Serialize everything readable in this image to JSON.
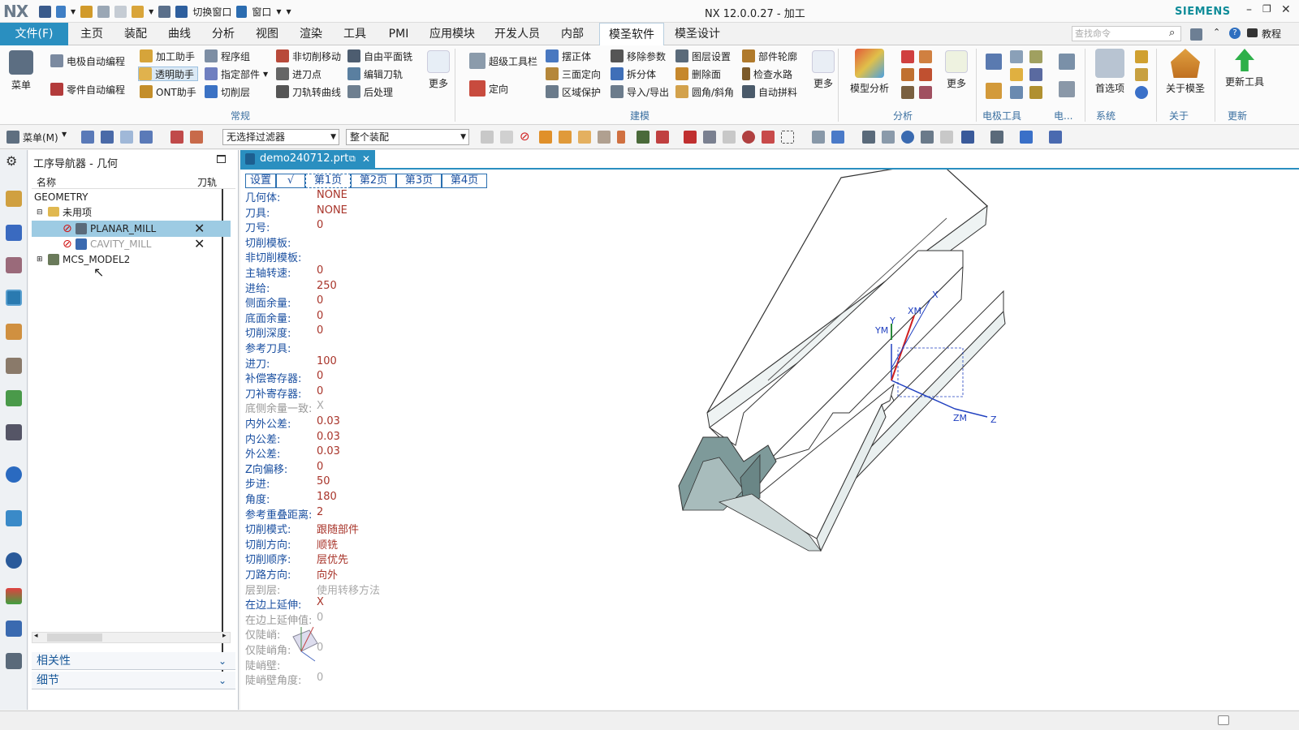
{
  "titlebar": {
    "logo": "NX",
    "switch_window": "切换窗口",
    "window_menu": "窗口",
    "title": "NX 12.0.0.27 - 加工",
    "brand": "SIEMENS"
  },
  "menu": {
    "file": "文件(F)",
    "tabs": [
      "主页",
      "装配",
      "曲线",
      "分析",
      "视图",
      "渲染",
      "工具",
      "PMI",
      "应用模块",
      "开发人员",
      "内部",
      "模圣软件",
      "模圣设计"
    ],
    "active_tab": "模圣软件",
    "search_placeholder": "查找命令",
    "tutorial": "教程"
  },
  "ribbon": {
    "menu_label": "菜单",
    "electrode_auto": "电极自动编程",
    "part_auto": "零件自动编程",
    "machining_helper": "加工助手",
    "transparent_helper": "透明助手",
    "ont_helper": "ONT助手",
    "program_group": "程序组",
    "specify_part": "指定部件",
    "cut_layer": "切削层",
    "non_cut_move": "非切削移动",
    "feed_point": "进刀点",
    "toolpath_curve": "刀轨转曲线",
    "free_plane_mill": "自由平面铣",
    "edit_toolpath": "编辑刀轨",
    "post_process": "后处理",
    "more1": "更多",
    "group_common": "常规",
    "super_toolbar": "超级工具栏",
    "orient": "定向",
    "straighten": "摆正体",
    "three_orient": "三面定向",
    "area_protect": "区域保护",
    "remove_params": "移除参数",
    "split_body": "拆分体",
    "import_export": "导入/导出",
    "layer_settings": "图层设置",
    "delete_face": "删除面",
    "fillet_chamfer": "圆角/斜角",
    "part_outline": "部件轮廓",
    "check_waterway": "检查水路",
    "auto_stitch": "自动拼料",
    "more2": "更多",
    "group_modeling": "建模",
    "model_analysis": "模型分析",
    "more3": "更多",
    "group_analysis": "分析",
    "group_electrode_tools": "电极工具",
    "group_electro": "电...",
    "preferences": "首选项",
    "group_system": "系统",
    "about_mosheng": "关于模圣",
    "group_about": "关于",
    "update_tools": "更新工具",
    "group_update": "更新"
  },
  "toolbar2": {
    "menu": "菜单(M)",
    "filter": "无选择过滤器",
    "assembly": "整个装配"
  },
  "navigator": {
    "title": "工序导航器 - 几何",
    "col_name": "名称",
    "col_path": "刀轨",
    "rows": [
      {
        "label": "GEOMETRY"
      },
      {
        "label": "未用项"
      },
      {
        "label": "PLANAR_MILL"
      },
      {
        "label": "CAVITY_MILL"
      },
      {
        "label": "MCS_MODEL2"
      }
    ],
    "dependencies": "相关性",
    "details": "细节"
  },
  "document": {
    "tab": "demo240712.prt"
  },
  "params": {
    "tabs": [
      "设置",
      "√",
      "第1页",
      "第2页",
      "第3页",
      "第4页"
    ],
    "rows": [
      {
        "label": "几何体:",
        "value": "NONE"
      },
      {
        "label": "刀具:",
        "value": "NONE"
      },
      {
        "label": "刀号:",
        "value": "0"
      },
      {
        "label": "切削模板:",
        "value": ""
      },
      {
        "label": "非切削模板:",
        "value": ""
      },
      {
        "label": "主轴转速:",
        "value": "0"
      },
      {
        "label": "进给:",
        "value": "250"
      },
      {
        "label": "侧面余量:",
        "value": "0"
      },
      {
        "label": "底面余量:",
        "value": "0"
      },
      {
        "label": "切削深度:",
        "value": "0"
      },
      {
        "label": "参考刀具:",
        "value": ""
      },
      {
        "label": "进刀:",
        "value": "100"
      },
      {
        "label": "补偿寄存器:",
        "value": "0"
      },
      {
        "label": "刀补寄存器:",
        "value": "0"
      },
      {
        "label": "底侧余量一致:",
        "value": "X",
        "dim": true
      },
      {
        "label": "内外公差:",
        "value": "0.03"
      },
      {
        "label": "内公差:",
        "value": "0.03"
      },
      {
        "label": "外公差:",
        "value": "0.03"
      },
      {
        "label": "Z向偏移:",
        "value": "0"
      },
      {
        "label": "步进:",
        "value": "50"
      },
      {
        "label": "角度:",
        "value": "180"
      },
      {
        "label": "参考重叠距离:",
        "value": "2"
      },
      {
        "label": "切削模式:",
        "value": "跟随部件"
      },
      {
        "label": "切削方向:",
        "value": "顺铣"
      },
      {
        "label": "切削顺序:",
        "value": "层优先"
      },
      {
        "label": "刀路方向:",
        "value": "向外"
      },
      {
        "label": "层到层:",
        "value": "使用转移方法",
        "dim": true
      },
      {
        "label": "在边上延伸:",
        "value": "X"
      },
      {
        "label": "在边上延伸值:",
        "value": "0",
        "dim": true
      },
      {
        "label": "仅陡峭:",
        "value": "",
        "dim": true
      },
      {
        "label": "仅陡峭角:",
        "value": "0",
        "dim": true
      },
      {
        "label": "陡峭壁:",
        "value": "",
        "dim": true
      },
      {
        "label": "陡峭壁角度:",
        "value": "0",
        "dim": true
      }
    ]
  },
  "viewport": {
    "axis_labels": [
      "X",
      "YM",
      "XM",
      "Y",
      "ZM",
      "Z"
    ]
  },
  "colors": {
    "accent": "#2a8fc0",
    "brand": "#0f8c99",
    "value_text": "#a8342a",
    "label_text": "#1a4fa0"
  }
}
